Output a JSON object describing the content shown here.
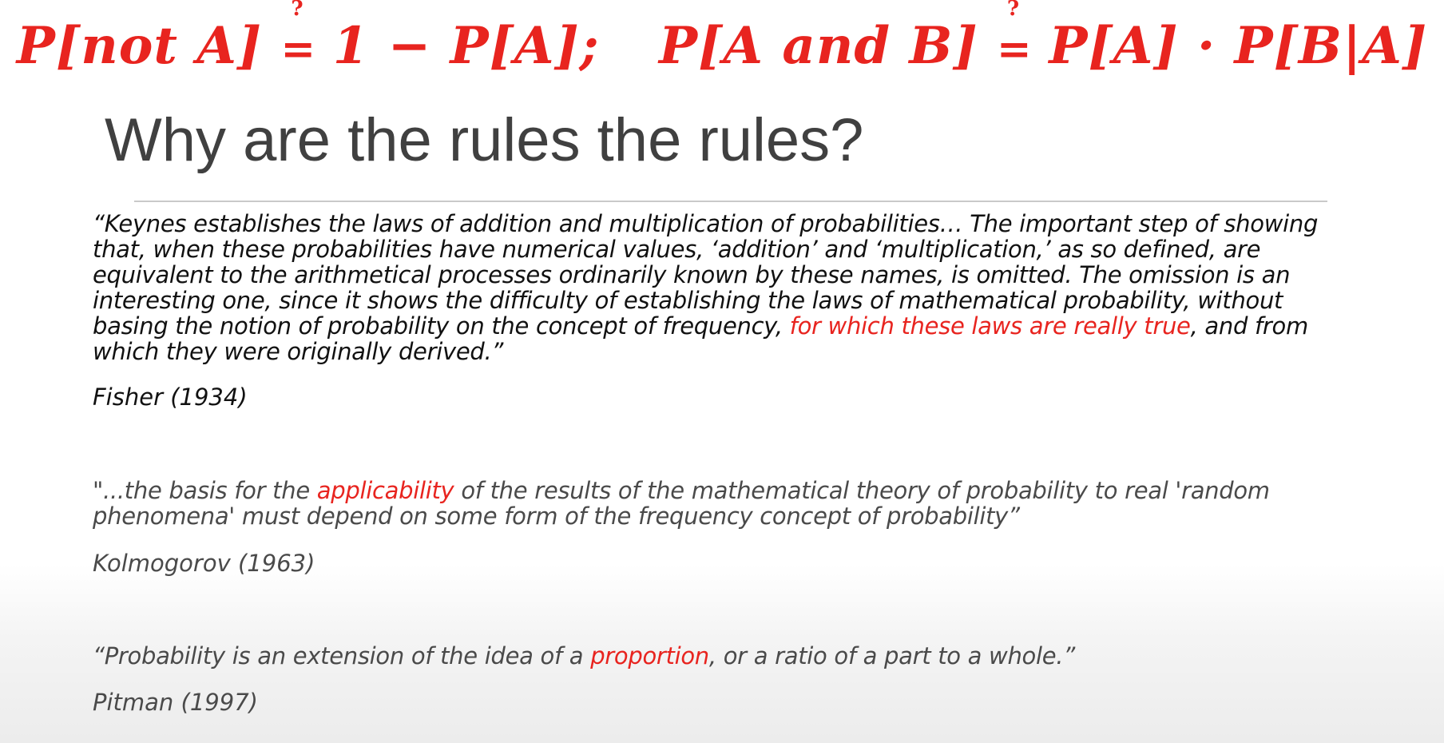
{
  "formula": {
    "part1_lhs": "P[not A]",
    "part1_q": "?",
    "part1_eq": "=",
    "part1_rhs": "1 − P[A];",
    "part2_lhs": "P[A and B]",
    "part2_q": "?",
    "part2_eq": "=",
    "part2_rhs": "P[A] · P[B|A]",
    "color": "#e8241f"
  },
  "title": "Why are the rules the rules?",
  "quotes": [
    {
      "text_before": "“Keynes establishes the laws of addition and multiplication of probabilities… The important step of showing that, when these probabilities have numerical values, ‘addition’ and ‘multiplication,’ as so defined, are equivalent to the arithmetical processes ordinarily known by these names, is omitted. The omission is an interesting one, since it shows the difficulty of establishing the laws of mathematical probability, without basing the notion of probability on the concept of frequency, ",
      "highlight": "for which these laws are really true",
      "text_after": ", and from which they were originally derived.”",
      "attribution": "Fisher (1934)"
    },
    {
      "text_before": "\"...the basis for the ",
      "highlight": "applicability",
      "text_after": " of the results of the mathematical theory of probability to real 'random phenomena' must depend on some form of the frequency concept of probability”",
      "attribution": "Kolmogorov (1963)"
    },
    {
      "text_before": "“Probability is an extension of the idea of a ",
      "highlight": "proportion",
      "text_after": ", or a ratio of a part to a whole.”",
      "attribution": "Pitman (1997)"
    }
  ],
  "colors": {
    "accent": "#e8241f",
    "title": "#404040",
    "quote_primary": "#111111",
    "quote_secondary": "#4a4a4a",
    "divider": "#c9c9c9"
  }
}
